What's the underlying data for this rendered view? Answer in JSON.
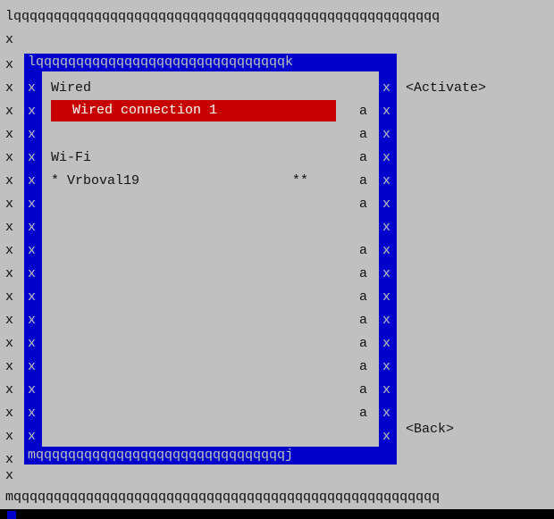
{
  "frame": {
    "top_border": "lqqqqqqqqqqqqqqqqqqqqqqqqqqqqqqqqqqqqqqqqqqqqqqqqqqqqq",
    "bottom_border": "mqqqqqqqqqqqqqqqqqqqqqqqqqqqqqqqqqqqqqqqqqqqqqqqqqqqqq",
    "side_char": "x"
  },
  "dialog": {
    "top_border": "lqqqqqqqqqqqqqqqqqqqqqqqqqqqqqqqk",
    "bottom_border": "mqqqqqqqqqqqqqqqqqqqqqqqqqqqqqqqj",
    "side_char": "x",
    "scroll_char": "a",
    "sections": {
      "wired_header": "Wired",
      "wifi_header": "Wi-Fi"
    },
    "connections": {
      "wired_selected": "Wired connection 1",
      "wifi_item": "* Vrboval19",
      "wifi_signal": "**"
    }
  },
  "buttons": {
    "activate": "<Activate>",
    "back": "<Back>"
  },
  "colors": {
    "background": "#c0c0c0",
    "dialog_border": "#0000cc",
    "selection": "#c70000",
    "text": "#111111",
    "selection_text": "#ffffff"
  }
}
